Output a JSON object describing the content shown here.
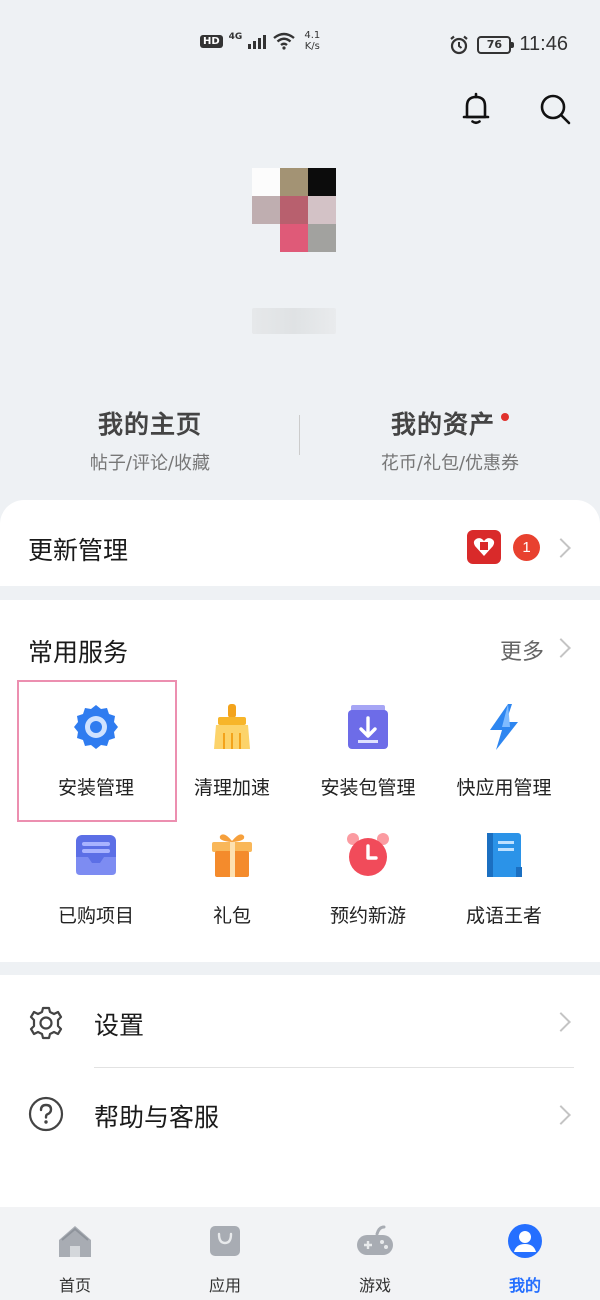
{
  "status_bar": {
    "hd": "HD",
    "network": "4G",
    "speed_value": "4.1",
    "speed_unit": "K/s",
    "battery": "76",
    "time": "11:46"
  },
  "header_icons": [
    "bell-icon",
    "search-icon"
  ],
  "profile": {
    "homepage_title": "我的主页",
    "homepage_sub": "帖子/评论/收藏",
    "assets_title": "我的资产",
    "assets_sub": "花币/礼包/优惠券"
  },
  "update": {
    "title": "更新管理",
    "badge_count": "1"
  },
  "services": {
    "title": "常用服务",
    "more": "更多",
    "items": [
      {
        "label": "安装管理",
        "icon": "gear-icon"
      },
      {
        "label": "清理加速",
        "icon": "broom-icon"
      },
      {
        "label": "安装包管理",
        "icon": "package-download-icon"
      },
      {
        "label": "快应用管理",
        "icon": "lightning-icon"
      },
      {
        "label": "已购项目",
        "icon": "tray-icon"
      },
      {
        "label": "礼包",
        "icon": "gift-icon"
      },
      {
        "label": "预约新游",
        "icon": "alarm-clock-icon"
      },
      {
        "label": "成语王者",
        "icon": "book-icon"
      }
    ]
  },
  "settings": {
    "settings_label": "设置",
    "help_label": "帮助与客服"
  },
  "bottom_nav": [
    {
      "label": "首页",
      "icon": "home-icon"
    },
    {
      "label": "应用",
      "icon": "bag-icon"
    },
    {
      "label": "游戏",
      "icon": "gamepad-icon"
    },
    {
      "label": "我的",
      "icon": "user-icon",
      "active": true
    }
  ],
  "colors": {
    "accent": "#256fff",
    "badge_red": "#e8412f",
    "highlight_border": "#ec8fb0"
  }
}
